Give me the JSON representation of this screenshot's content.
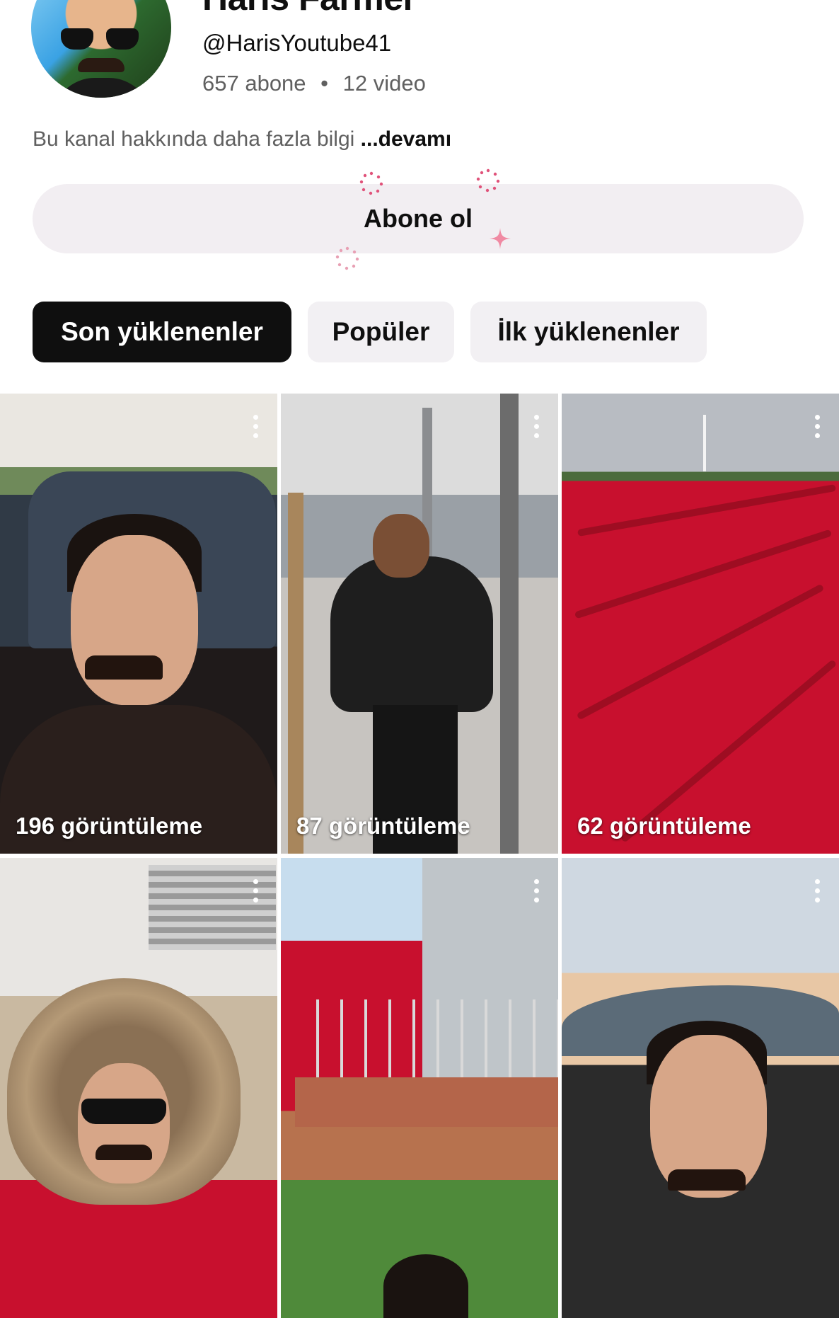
{
  "channel": {
    "name": "Haris Farmer",
    "handle": "@HarisYoutube41",
    "subscribers": "657 abone",
    "separator": "•",
    "videos": "12 video",
    "about": "Bu kanal hakkında daha fazla bilgi",
    "about_more": "...devamı"
  },
  "subscribe": {
    "label": "Abone ol"
  },
  "sort_chips": [
    {
      "label": "Son yüklenenler",
      "selected": true
    },
    {
      "label": "Popüler",
      "selected": false
    },
    {
      "label": "İlk yüklenenler",
      "selected": false
    }
  ],
  "videos": [
    {
      "views": "196 görüntüleme"
    },
    {
      "views": "87 görüntüleme"
    },
    {
      "views": "62 görüntüleme"
    },
    {
      "views": ""
    },
    {
      "views": ""
    },
    {
      "views": ""
    }
  ],
  "colors": {
    "chip_active_bg": "#0f0f0f",
    "chip_inactive_bg": "#f2f0f3",
    "subscribe_bg": "#f2eef2",
    "sparkle": "#e0527a"
  }
}
